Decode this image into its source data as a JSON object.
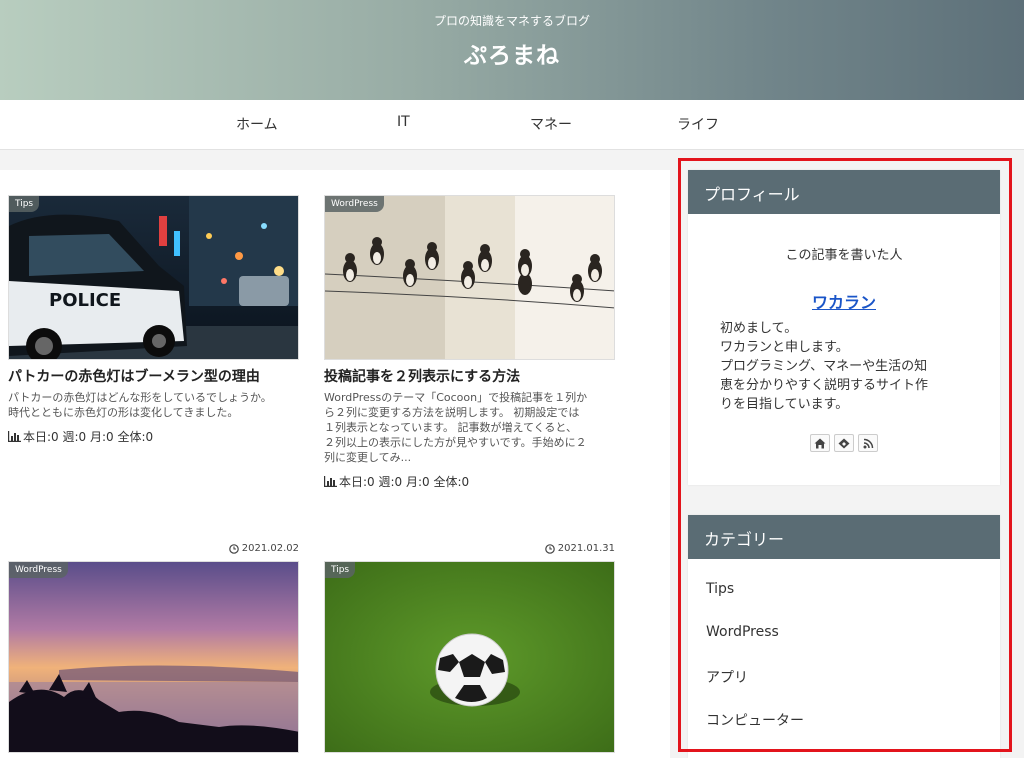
{
  "header": {
    "tagline": "プロの知識をマネするブログ",
    "site_title": "ぷろまね"
  },
  "nav": {
    "items": [
      "ホーム",
      "IT",
      "マネー",
      "ライフ"
    ]
  },
  "posts": [
    {
      "category": "Tips",
      "title": "パトカーの赤色灯はブーメラン型の理由",
      "snippet": [
        "パトカーの赤色灯はどんな形をしているでしょうか。",
        "時代とともに赤色灯の形は変化してきました。"
      ],
      "views": "本日:0 週:0 月:0 全体:0",
      "date": "2021.02.02"
    },
    {
      "category": "WordPress",
      "title": "投稿記事を２列表示にする方法",
      "snippet": [
        "WordPressのテーマ「Cocoon」で投稿記事を１列か",
        "ら２列に変更する方法を説明します。 初期設定では",
        "１列表示となっています。 記事数が増えてくると、",
        "２列以上の表示にした方が見やすいです。手始めに２",
        "列に変更してみ..."
      ],
      "views": "本日:0 週:0 月:0 全体:0",
      "date": "2021.01.31"
    },
    {
      "category": "WordPress"
    },
    {
      "category": "Tips"
    }
  ],
  "sidebar": {
    "profile": {
      "heading": "プロフィール",
      "subheading": "この記事を書いた人",
      "name": "ワカラン",
      "bio": [
        "初めまして。",
        "ワカランと申します。",
        "プログラミング、マネーや生活の知",
        "恵を分かりやすく説明するサイト作",
        "りを目指しています。"
      ],
      "icons": [
        "home-icon",
        "feedly-icon",
        "rss-icon"
      ]
    },
    "categories": {
      "heading": "カテゴリー",
      "items": [
        "Tips",
        "WordPress",
        "アプリ",
        "コンピューター"
      ]
    }
  },
  "colors": {
    "widget_header": "#5a6c74",
    "highlight_border": "#e3141c",
    "profile_link": "#1a55c8"
  }
}
